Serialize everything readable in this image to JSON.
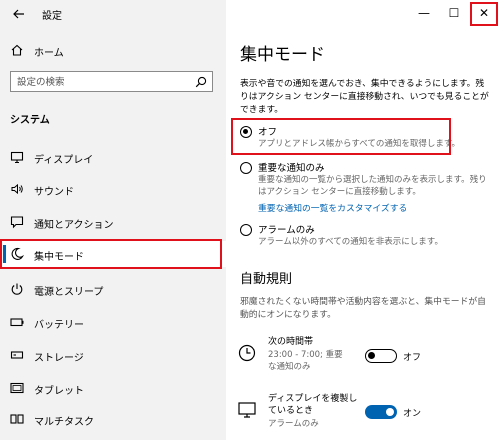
{
  "window": {
    "title": "設定",
    "minimize": "—",
    "maximize": "☐",
    "close": "✕"
  },
  "sidebar": {
    "home_label": "ホーム",
    "search_placeholder": "設定の検索",
    "section_title": "システム",
    "items": [
      {
        "label": "ディスプレイ",
        "icon": "display-icon"
      },
      {
        "label": "サウンド",
        "icon": "sound-icon"
      },
      {
        "label": "通知とアクション",
        "icon": "notification-icon"
      },
      {
        "label": "集中モード",
        "icon": "moon-icon",
        "active": true
      },
      {
        "label": "電源とスリープ",
        "icon": "power-icon"
      },
      {
        "label": "バッテリー",
        "icon": "battery-icon"
      },
      {
        "label": "ストレージ",
        "icon": "storage-icon"
      },
      {
        "label": "タブレット",
        "icon": "tablet-icon"
      },
      {
        "label": "マルチタスク",
        "icon": "multitask-icon"
      }
    ]
  },
  "main": {
    "title": "集中モード",
    "description": "表示や音での通知を選んでおき、集中できるようにします。残りはアクション センターに直接移動され、いつでも見ることができます。",
    "options": [
      {
        "title": "オフ",
        "description": "アプリとアドレス帳からすべての通知を取得します。",
        "selected": true
      },
      {
        "title": "重要な通知のみ",
        "description": "重要な通知の一覧から選択した通知のみを表示します。残りはアクション センターに直接移動します。",
        "link": "重要な通知の一覧をカスタマイズする",
        "selected": false
      },
      {
        "title": "アラームのみ",
        "description": "アラーム以外のすべての通知を非表示にします。",
        "selected": false
      }
    ],
    "auto_rules": {
      "title": "自動規則",
      "description": "邪魔されたくない時間帯や活動内容を選ぶと、集中モードが自動的にオンになります。",
      "rules": [
        {
          "title": "次の時間帯",
          "description": "23:00 - 7:00; 重要な通知のみ",
          "toggle_label": "オフ",
          "on": false,
          "icon": "clock-icon"
        },
        {
          "title": "ディスプレイを複製しているとき",
          "description": "アラームのみ",
          "toggle_label": "オン",
          "on": true,
          "icon": "monitor-icon"
        }
      ]
    }
  },
  "colors": {
    "accent": "#0063b1",
    "highlight": "#e0111b",
    "sidebar_bg": "#f2f2f2"
  }
}
